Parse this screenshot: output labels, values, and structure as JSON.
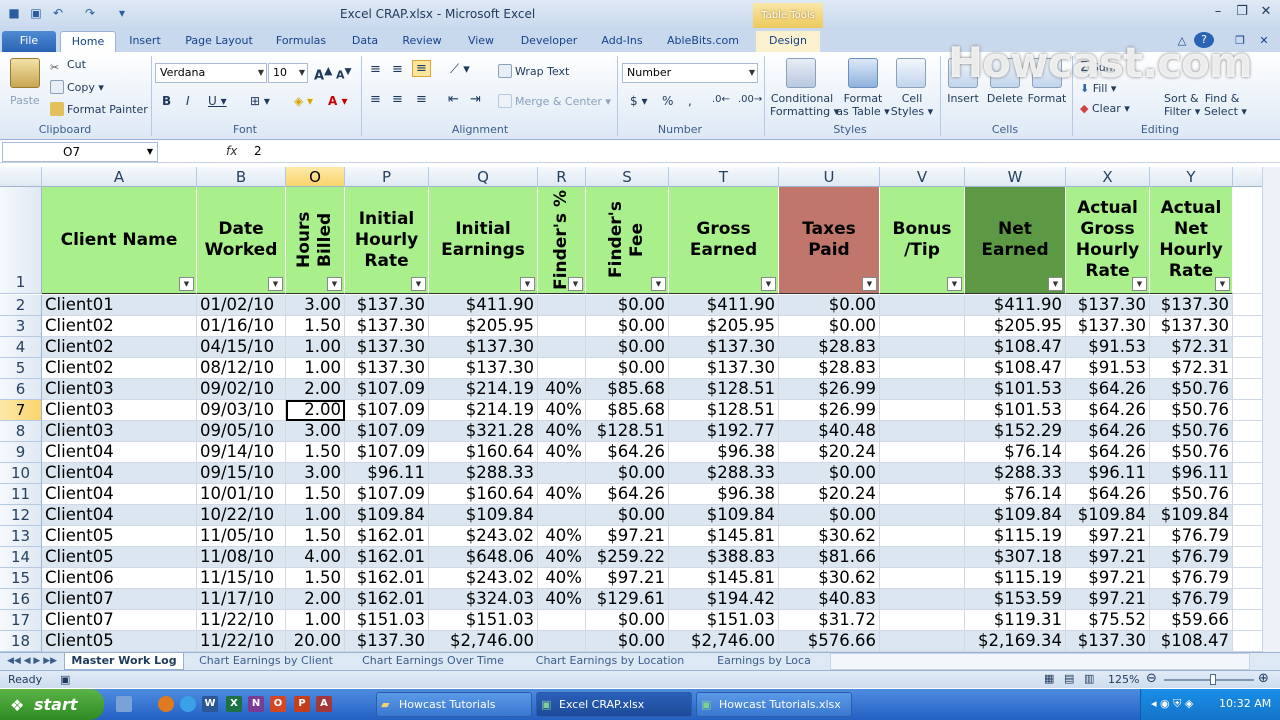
{
  "window": {
    "title": "Excel CRAP.xlsx - Microsoft Excel",
    "contextual_tab": "Table Tools"
  },
  "tabs": [
    "File",
    "Home",
    "Insert",
    "Page Layout",
    "Formulas",
    "Data",
    "Review",
    "View",
    "Developer",
    "Add-Ins",
    "AbleBits.com",
    "Design"
  ],
  "ribbon": {
    "clipboard": {
      "paste": "Paste",
      "cut": "Cut",
      "copy": "Copy",
      "format_painter": "Format Painter",
      "label": "Clipboard"
    },
    "font": {
      "name": "Verdana",
      "size": "10",
      "label": "Font"
    },
    "alignment": {
      "wrap": "Wrap Text",
      "merge": "Merge & Center",
      "label": "Alignment"
    },
    "number": {
      "format": "Number",
      "label": "Number"
    },
    "styles": {
      "cond1": "Conditional",
      "cond2": "Formatting",
      "fmt1": "Format",
      "fmt2": "as Table",
      "cell1": "Cell",
      "cell2": "Styles",
      "label": "Styles"
    },
    "cells": {
      "insert": "Insert",
      "delete": "Delete",
      "format": "Format",
      "label": "Cells"
    },
    "editing": {
      "autosum": "Sum",
      "fill": "Fill",
      "clear": "Clear",
      "sort1": "Sort &",
      "sort2": "Filter",
      "find1": "Find &",
      "find2": "Select",
      "label": "Editing"
    }
  },
  "watermark": "Howcast.com",
  "formula_bar": {
    "name_box": "O7",
    "fx": "fx",
    "value": "2"
  },
  "columns": [
    {
      "letter": "A",
      "header": "Client Name"
    },
    {
      "letter": "B",
      "header": "Date Worked"
    },
    {
      "letter": "O",
      "header": "Hours Billed"
    },
    {
      "letter": "P",
      "header": "Initial Hourly Rate"
    },
    {
      "letter": "Q",
      "header": "Initial Earnings"
    },
    {
      "letter": "R",
      "header": "Finder's %"
    },
    {
      "letter": "S",
      "header": "Finder's Fee"
    },
    {
      "letter": "T",
      "header": "Gross Earned"
    },
    {
      "letter": "U",
      "header": "Taxes Paid"
    },
    {
      "letter": "V",
      "header": "Bonus /Tip"
    },
    {
      "letter": "W",
      "header": "Net Earned"
    },
    {
      "letter": "X",
      "header": "Actual Gross Hourly Rate"
    },
    {
      "letter": "Y",
      "header": "Actual Net Hourly Rate"
    }
  ],
  "header_row_number": "1",
  "rows": [
    {
      "n": "2",
      "cells": [
        "Client01",
        "01/02/10",
        "3.00",
        "$137.30",
        "$411.90",
        "",
        "$0.00",
        "$411.90",
        "$0.00",
        "",
        "$411.90",
        "$137.30",
        "$137.30"
      ]
    },
    {
      "n": "3",
      "cells": [
        "Client02",
        "01/16/10",
        "1.50",
        "$137.30",
        "$205.95",
        "",
        "$0.00",
        "$205.95",
        "$0.00",
        "",
        "$205.95",
        "$137.30",
        "$137.30"
      ]
    },
    {
      "n": "4",
      "cells": [
        "Client02",
        "04/15/10",
        "1.00",
        "$137.30",
        "$137.30",
        "",
        "$0.00",
        "$137.30",
        "$28.83",
        "",
        "$108.47",
        "$91.53",
        "$72.31"
      ]
    },
    {
      "n": "5",
      "cells": [
        "Client02",
        "08/12/10",
        "1.00",
        "$137.30",
        "$137.30",
        "",
        "$0.00",
        "$137.30",
        "$28.83",
        "",
        "$108.47",
        "$91.53",
        "$72.31"
      ]
    },
    {
      "n": "6",
      "cells": [
        "Client03",
        "09/02/10",
        "2.00",
        "$107.09",
        "$214.19",
        "40%",
        "$85.68",
        "$128.51",
        "$26.99",
        "",
        "$101.53",
        "$64.26",
        "$50.76"
      ]
    },
    {
      "n": "7",
      "cells": [
        "Client03",
        "09/03/10",
        "2.00",
        "$107.09",
        "$214.19",
        "40%",
        "$85.68",
        "$128.51",
        "$26.99",
        "",
        "$101.53",
        "$64.26",
        "$50.76"
      ]
    },
    {
      "n": "8",
      "cells": [
        "Client03",
        "09/05/10",
        "3.00",
        "$107.09",
        "$321.28",
        "40%",
        "$128.51",
        "$192.77",
        "$40.48",
        "",
        "$152.29",
        "$64.26",
        "$50.76"
      ]
    },
    {
      "n": "9",
      "cells": [
        "Client04",
        "09/14/10",
        "1.50",
        "$107.09",
        "$160.64",
        "40%",
        "$64.26",
        "$96.38",
        "$20.24",
        "",
        "$76.14",
        "$64.26",
        "$50.76"
      ]
    },
    {
      "n": "10",
      "cells": [
        "Client04",
        "09/15/10",
        "3.00",
        "$96.11",
        "$288.33",
        "",
        "$0.00",
        "$288.33",
        "$0.00",
        "",
        "$288.33",
        "$96.11",
        "$96.11"
      ]
    },
    {
      "n": "11",
      "cells": [
        "Client04",
        "10/01/10",
        "1.50",
        "$107.09",
        "$160.64",
        "40%",
        "$64.26",
        "$96.38",
        "$20.24",
        "",
        "$76.14",
        "$64.26",
        "$50.76"
      ]
    },
    {
      "n": "12",
      "cells": [
        "Client04",
        "10/22/10",
        "1.00",
        "$109.84",
        "$109.84",
        "",
        "$0.00",
        "$109.84",
        "$0.00",
        "",
        "$109.84",
        "$109.84",
        "$109.84"
      ]
    },
    {
      "n": "13",
      "cells": [
        "Client05",
        "11/05/10",
        "1.50",
        "$162.01",
        "$243.02",
        "40%",
        "$97.21",
        "$145.81",
        "$30.62",
        "",
        "$115.19",
        "$97.21",
        "$76.79"
      ]
    },
    {
      "n": "14",
      "cells": [
        "Client05",
        "11/08/10",
        "4.00",
        "$162.01",
        "$648.06",
        "40%",
        "$259.22",
        "$388.83",
        "$81.66",
        "",
        "$307.18",
        "$97.21",
        "$76.79"
      ]
    },
    {
      "n": "15",
      "cells": [
        "Client06",
        "11/15/10",
        "1.50",
        "$162.01",
        "$243.02",
        "40%",
        "$97.21",
        "$145.81",
        "$30.62",
        "",
        "$115.19",
        "$97.21",
        "$76.79"
      ]
    },
    {
      "n": "16",
      "cells": [
        "Client07",
        "11/17/10",
        "2.00",
        "$162.01",
        "$324.03",
        "40%",
        "$129.61",
        "$194.42",
        "$40.83",
        "",
        "$153.59",
        "$97.21",
        "$76.79"
      ]
    },
    {
      "n": "17",
      "cells": [
        "Client07",
        "11/22/10",
        "1.00",
        "$151.03",
        "$151.03",
        "",
        "$0.00",
        "$151.03",
        "$31.72",
        "",
        "$119.31",
        "$75.52",
        "$59.66"
      ]
    },
    {
      "n": "18",
      "cells": [
        "Client05",
        "11/22/10",
        "20.00",
        "$137.30",
        "$2,746.00",
        "",
        "$0.00",
        "$2,746.00",
        "$576.66",
        "",
        "$2,169.34",
        "$137.30",
        "$108.47"
      ]
    }
  ],
  "sheet_tabs": [
    "Master Work Log",
    "Chart Earnings by Client",
    "Chart Earnings Over Time",
    "Chart Earnings by Location",
    "Earnings by Loca"
  ],
  "status": {
    "mode": "Ready",
    "zoom": "125%"
  },
  "taskbar": {
    "start": "start",
    "items": [
      "Howcast Tutorials",
      "Excel CRAP.xlsx",
      "Howcast Tutorials.xlsx"
    ],
    "clock": "10:32 AM",
    "quick_launch": [
      "W",
      "X",
      "N",
      "O",
      "P",
      "A"
    ]
  },
  "colors": {
    "header_green": "#a9f08c",
    "taxes_header": "#c0766a",
    "net_header": "#5d9944",
    "band_blue": "#dce6f1",
    "accent": "#2a63b4"
  }
}
